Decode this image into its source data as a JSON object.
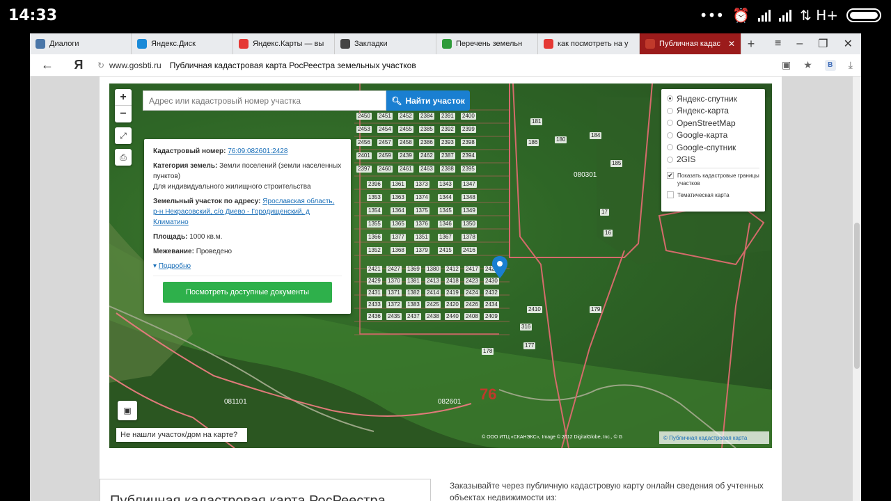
{
  "status": {
    "time": "14:33",
    "network": "H+"
  },
  "tabs": [
    {
      "label": "Диалоги",
      "icon": "chat-icon",
      "color": "#4a76a8"
    },
    {
      "label": "Яндекс.Диск",
      "icon": "disk-icon",
      "color": "#1a8ad8"
    },
    {
      "label": "Яндекс.Карты — вы",
      "icon": "pin-icon",
      "color": "#e53935"
    },
    {
      "label": "Закладки",
      "icon": "star-icon",
      "color": "#444"
    },
    {
      "label": "Перечень земельн",
      "icon": "doc-icon",
      "color": "#2e9b3a"
    },
    {
      "label": "как посмотреть на у",
      "icon": "yandex-icon",
      "color": "#e53935"
    },
    {
      "label": "Публичная кадас",
      "icon": "flag-icon",
      "color": "#c0392b",
      "active": true
    }
  ],
  "address": {
    "domain": "www.gosbti.ru",
    "title": "Публичная кадастровая карта РосРеестра земельных участков",
    "ya": "Я"
  },
  "map": {
    "search_placeholder": "Адрес или кадастровый номер участка",
    "search_button": "Найти участок",
    "layers": [
      {
        "label": "Яндекс-спутник",
        "selected": true
      },
      {
        "label": "Яндекс-карта",
        "selected": false
      },
      {
        "label": "OpenStreetMap",
        "selected": false
      },
      {
        "label": "Google-карта",
        "selected": false
      },
      {
        "label": "Google-спутник",
        "selected": false
      },
      {
        "label": "2GIS",
        "selected": false
      }
    ],
    "check_borders": "Показать кадастровые границы участков",
    "check_thematic": "Тематическая карта",
    "not_found": "Не нашли участок/дом на карте?",
    "copyright": "© ООО ИТЦ «СКАНЭКС», Image © 2012 DigitalGlobe, Inc., © G",
    "pkk_label": "© Публичная кадастровая карта",
    "region_number": "76",
    "quarters": [
      "082601",
      "081101",
      "080301"
    ],
    "parcels": [
      "2450",
      "2451",
      "2452",
      "2384",
      "2391",
      "2400",
      "2453",
      "2454",
      "2455",
      "2385",
      "2392",
      "2399",
      "2456",
      "2457",
      "2458",
      "2386",
      "2393",
      "2398",
      "2401",
      "2459",
      "2439",
      "2462",
      "2387",
      "2394",
      "2397",
      "2460",
      "2461",
      "2463",
      "2388",
      "2395",
      "2396",
      "1361",
      "1373",
      "1343",
      "1347",
      "1353",
      "1363",
      "1374",
      "1344",
      "1348",
      "1354",
      "1364",
      "1375",
      "1345",
      "1349",
      "1355",
      "1365",
      "1376",
      "1346",
      "1350",
      "1366",
      "1377",
      "1351",
      "1367",
      "1378",
      "1352",
      "1368",
      "1379",
      "2415",
      "2416",
      "2421",
      "2427",
      "1369",
      "1380",
      "2412",
      "2417",
      "2422",
      "2429",
      "1370",
      "1381",
      "2413",
      "2418",
      "2423",
      "2430",
      "2431",
      "1371",
      "1382",
      "2414",
      "2419",
      "2424",
      "2432",
      "2433",
      "1372",
      "1383",
      "2425",
      "2420",
      "2426",
      "2434",
      "2436",
      "2435",
      "2437",
      "2438",
      "2440",
      "2408",
      "2409",
      "2410",
      "316",
      "177",
      "178",
      "179",
      "180",
      "181",
      "186",
      "184",
      "185",
      "16",
      "17"
    ]
  },
  "info": {
    "cad_label": "Кадастровый номер:",
    "cad_value": "76:09:082601:2428",
    "cat_label": "Категория земель:",
    "cat_value": "Земли поселений (земли населенных пунктов)",
    "usage": "Для индивидуального жилищного строительства",
    "addr_label": "Земельный участок по адресу:",
    "addr_value": "Ярославская область, р-н Некрасовский, с/о Диево - Городищенский, д Климатино",
    "area_label": "Площадь:",
    "area_value": "1000 кв.м.",
    "survey_label": "Межевание:",
    "survey_value": "Проведено",
    "more": "Подробно",
    "docs_button": "Посмотреть доступные документы"
  },
  "bottom": {
    "heading": "Публичная кадастровая карта РосРеестра",
    "text": "Заказывайте через публичную кадастровую карту онлайн сведения об учтенных объектах недвижимости из:"
  }
}
